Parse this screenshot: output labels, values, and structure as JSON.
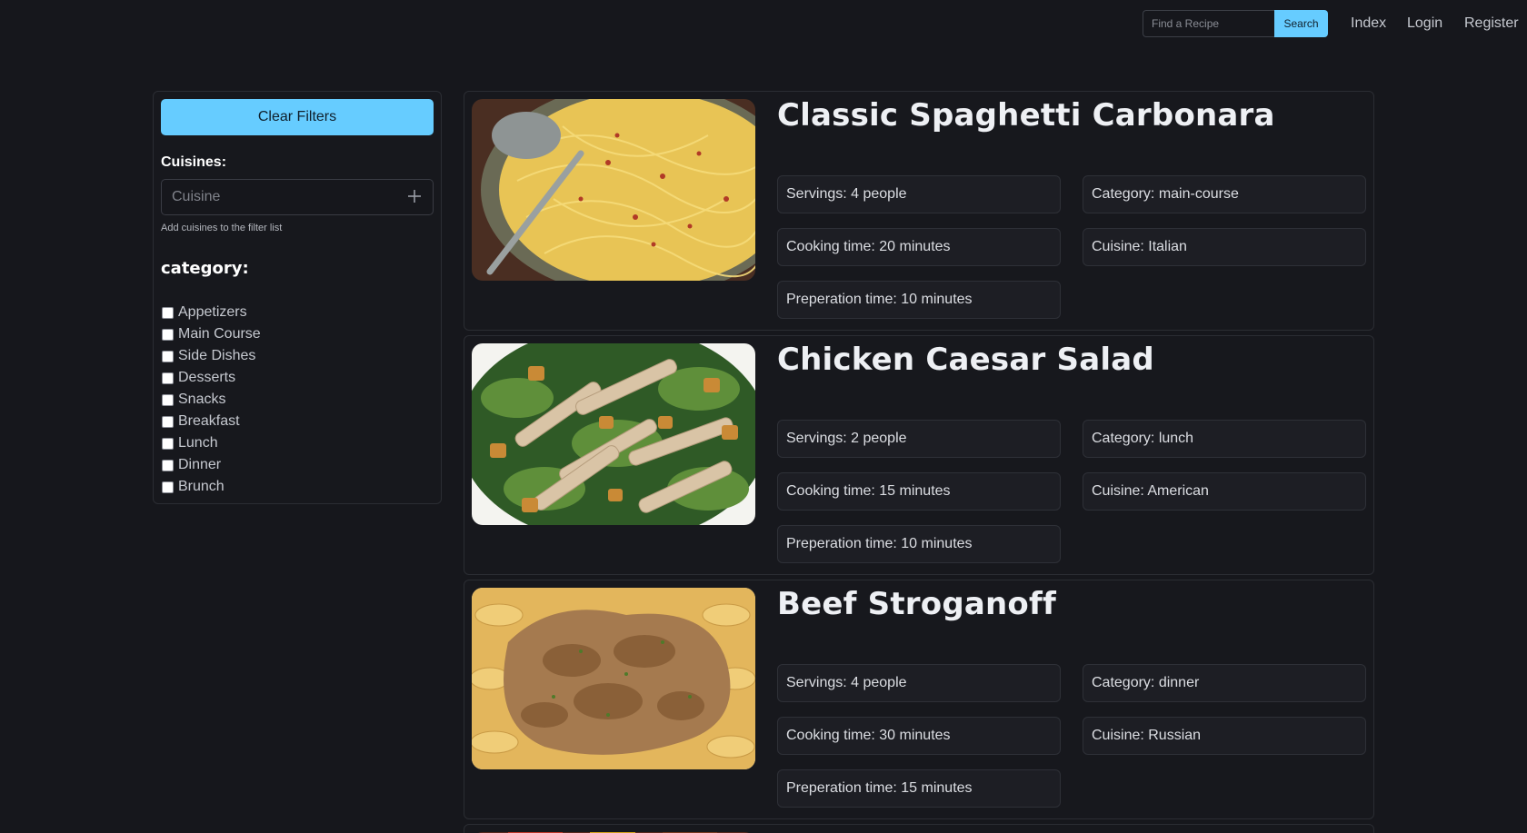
{
  "nav": {
    "search_placeholder": "Find a Recipe",
    "search_button": "Search",
    "links": {
      "index": "Index",
      "login": "Login",
      "register": "Register"
    }
  },
  "sidebar": {
    "clear_filters": "Clear Filters",
    "cuisines_label": "Cuisines:",
    "cuisine_placeholder": "Cuisine",
    "cuisine_help": "Add cuisines to the filter list",
    "category_label": "category:",
    "categories": [
      "Appetizers",
      "Main Course",
      "Side Dishes",
      "Desserts",
      "Snacks",
      "Breakfast",
      "Lunch",
      "Dinner",
      "Brunch"
    ]
  },
  "recipes": [
    {
      "title": "Classic Spaghetti Carbonara",
      "servings": "Servings: 4 people",
      "category": "Category: main-course",
      "cooking_time": "Cooking time: 20 minutes",
      "cuisine": "Cuisine: Italian",
      "prep_time": "Preperation time: 10 minutes"
    },
    {
      "title": "Chicken Caesar Salad",
      "servings": "Servings: 2 people",
      "category": "Category: lunch",
      "cooking_time": "Cooking time: 15 minutes",
      "cuisine": "Cuisine: American",
      "prep_time": "Preperation time: 10 minutes"
    },
    {
      "title": "Beef Stroganoff",
      "servings": "Servings: 4 people",
      "category": "Category: dinner",
      "cooking_time": "Cooking time: 30 minutes",
      "cuisine": "Cuisine: Russian",
      "prep_time": "Preperation time: 15 minutes"
    }
  ],
  "colors": {
    "background": "#16171c",
    "accent": "#66ccff",
    "card_border": "#2b2d33",
    "pill_background": "#1d1e24"
  }
}
